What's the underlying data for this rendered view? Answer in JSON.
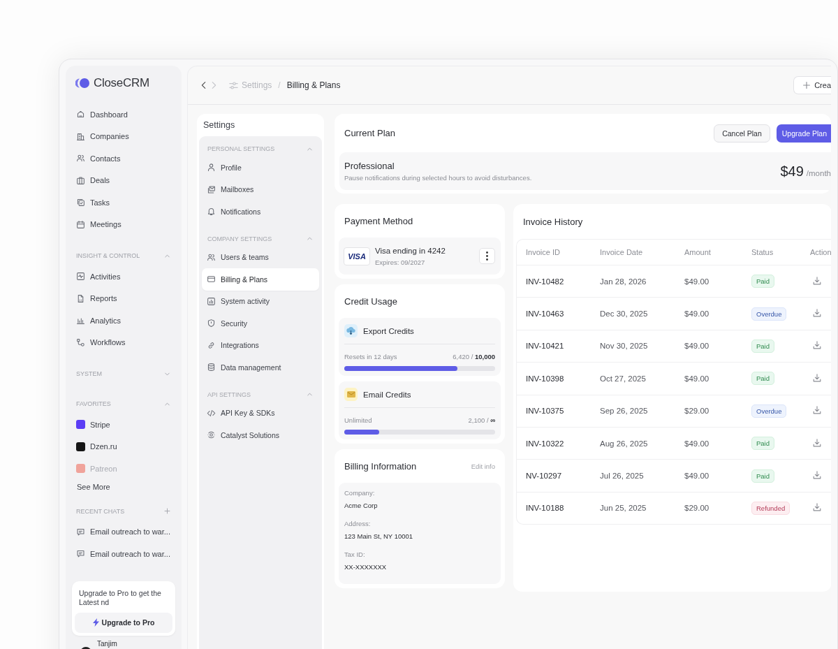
{
  "app": {
    "logo": "CloseCRM"
  },
  "sidebar": {
    "nav": [
      {
        "label": "Dashboard",
        "selected": false
      },
      {
        "label": "Companies",
        "selected": false
      },
      {
        "label": "Contacts",
        "selected": false
      },
      {
        "label": "Deals",
        "selected": false
      },
      {
        "label": "Tasks",
        "selected": false
      },
      {
        "label": "Meetings",
        "selected": false
      }
    ],
    "sections": [
      {
        "kind": "links",
        "title": "INSIGHT & CONTROL",
        "expanded": true,
        "items": [
          {
            "label": "Activities"
          },
          {
            "label": "Reports"
          },
          {
            "label": "Analytics"
          },
          {
            "label": "Workflows"
          }
        ]
      },
      {
        "kind": "links",
        "title": "SYSTEM",
        "expanded": false
      },
      {
        "kind": "favorites",
        "title": "FAVORITES",
        "expanded": true,
        "items": [
          {
            "label": "Stripe",
            "color": "#5b3df5",
            "faded": false
          },
          {
            "label": "Dzen.ru",
            "color": "#161616",
            "faded": false
          },
          {
            "label": "Patreon",
            "color": "#f0a39b",
            "faded": true
          }
        ],
        "more": "See More"
      },
      {
        "kind": "chats",
        "title": "RECENT CHATS",
        "items": [
          {
            "label": "Email outreach to war..."
          },
          {
            "label": "Email outreach to war..."
          }
        ]
      }
    ],
    "upgrade": {
      "text": "Upgrade to Pro to get the Latest nd",
      "button": "Upgrade to Pro"
    },
    "user": {
      "name": "Tanjim"
    }
  },
  "topbar": {
    "breadcrumb": [
      "Settings",
      "Billing & Plans"
    ],
    "separator": "/",
    "create_button": "Crea"
  },
  "settings": {
    "title": "Settings",
    "groups": [
      {
        "title": "PERSONAL SETTINGS",
        "expanded": true,
        "items": [
          {
            "label": "Profile",
            "selected": false
          },
          {
            "label": "Mailboxes",
            "selected": false
          },
          {
            "label": "Notifications",
            "selected": false
          }
        ]
      },
      {
        "title": "COMPANY SETTINGS",
        "expanded": true,
        "items": [
          {
            "label": "Users & teams",
            "selected": false
          },
          {
            "label": "Billing & Plans",
            "selected": true
          },
          {
            "label": "System activity",
            "selected": false
          },
          {
            "label": "Security",
            "selected": false
          },
          {
            "label": "Integrations",
            "selected": false
          },
          {
            "label": "Data management",
            "selected": false
          }
        ]
      },
      {
        "title": "API SETTINGS",
        "expanded": true,
        "items": [
          {
            "label": "API Key & SDKs",
            "selected": false
          },
          {
            "label": "Catalyst Solutions",
            "selected": false
          }
        ]
      }
    ]
  },
  "current_plan": {
    "title": "Current Plan",
    "cancel_button": "Cancel Plan",
    "upgrade_button": "Upgrade Plan",
    "plan": "Professional",
    "description": "Pause notifications during selected hours to avoid disturbances.",
    "price": "$49",
    "period": "/month"
  },
  "payment_method": {
    "title": "Payment Method",
    "brand": "VISA",
    "card": "Visa ending in 4242",
    "expires": "Expires: 09/2027"
  },
  "credit_usage": {
    "title": "Credit Usage",
    "items": [
      {
        "kind": "export",
        "name": "Export Credits",
        "note": "Resets in 12 days",
        "reading": "6,420 / **10,000**",
        "level": 0.75
      },
      {
        "kind": "email",
        "name": "Email Credits",
        "note": "Unlimited",
        "reading": "2,100 / **∞**",
        "level": 0.23
      }
    ]
  },
  "billing_information": {
    "title": "Billing Information",
    "edit_link": "Edit info",
    "fields": [
      {
        "label": "Company:",
        "value": "Acme Corp"
      },
      {
        "label": "Address:",
        "value": "123 Main St, NY 10001"
      },
      {
        "label": "Tax ID:",
        "value": "XX-XXXXXXX"
      }
    ]
  },
  "invoice_history": {
    "title": "Invoice History",
    "columns": [
      "Invoice ID",
      "Invoice Date",
      "Amount",
      "Status",
      "Action"
    ],
    "rows": [
      {
        "id": "INV-10482",
        "date": "Jan 28, 2026",
        "amount": "$49.00",
        "status": "Paid",
        "kind": "paid"
      },
      {
        "id": "INV-10463",
        "date": "Dec 30, 2025",
        "amount": "$49.00",
        "status": "Overdue",
        "kind": "overdue"
      },
      {
        "id": "INV-10421",
        "date": "Nov 30, 2025",
        "amount": "$49.00",
        "status": "Paid",
        "kind": "paid"
      },
      {
        "id": "INV-10398",
        "date": "Oct 27, 2025",
        "amount": "$49.00",
        "status": "Paid",
        "kind": "paid"
      },
      {
        "id": "INV-10375",
        "date": "Sep 26, 2025",
        "amount": "$29.00",
        "status": "Overdue",
        "kind": "overdue"
      },
      {
        "id": "INV-10322",
        "date": "Aug 26, 2025",
        "amount": "$49.00",
        "status": "Paid",
        "kind": "paid"
      },
      {
        "id": "NV-10297",
        "date": "Jul 26, 2025",
        "amount": "$49.00",
        "status": "Paid",
        "kind": "paid"
      },
      {
        "id": "INV-10188",
        "date": "Jun 25, 2025",
        "amount": "$29.00",
        "status": "Refunded",
        "kind": "refunded"
      }
    ]
  }
}
